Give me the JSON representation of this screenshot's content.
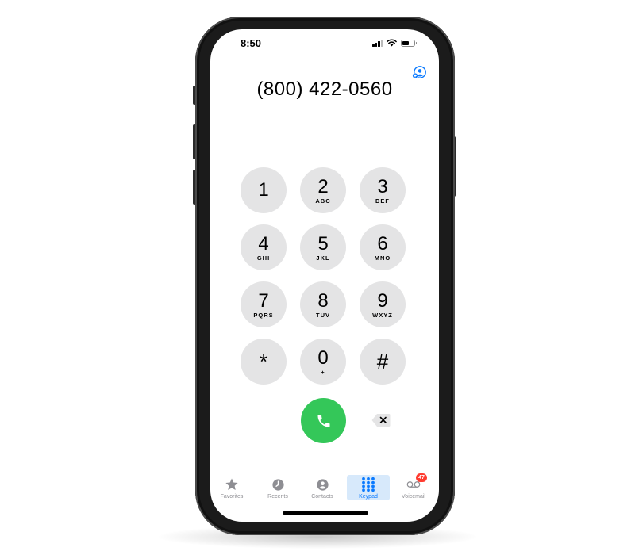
{
  "status_bar": {
    "time": "8:50",
    "signal_bars": 4,
    "battery_level": 0.6
  },
  "dialer": {
    "number": "(800) 422-0560",
    "add_contact_icon": "add-contact-icon"
  },
  "keypad": {
    "keys": [
      {
        "digit": "1",
        "letters": ""
      },
      {
        "digit": "2",
        "letters": "ABC"
      },
      {
        "digit": "3",
        "letters": "DEF"
      },
      {
        "digit": "4",
        "letters": "GHI"
      },
      {
        "digit": "5",
        "letters": "JKL"
      },
      {
        "digit": "6",
        "letters": "MNO"
      },
      {
        "digit": "7",
        "letters": "PQRS"
      },
      {
        "digit": "8",
        "letters": "TUV"
      },
      {
        "digit": "9",
        "letters": "WXYZ"
      },
      {
        "digit": "*",
        "letters": ""
      },
      {
        "digit": "0",
        "letters": "+"
      },
      {
        "digit": "#",
        "letters": ""
      }
    ],
    "call_icon": "phone-icon",
    "delete_icon": "backspace-icon"
  },
  "tab_bar": {
    "tabs": [
      {
        "label": "Favorites",
        "icon": "star-icon",
        "active": false
      },
      {
        "label": "Recents",
        "icon": "clock-icon",
        "active": false
      },
      {
        "label": "Contacts",
        "icon": "person-icon",
        "active": false
      },
      {
        "label": "Keypad",
        "icon": "keypad-icon",
        "active": true
      },
      {
        "label": "Voicemail",
        "icon": "voicemail-icon",
        "active": false,
        "badge": "47"
      }
    ]
  },
  "colors": {
    "call_green": "#34c759",
    "accent_blue": "#0a7aff",
    "key_gray": "#e4e4e5",
    "badge_red": "#ff3b30"
  }
}
